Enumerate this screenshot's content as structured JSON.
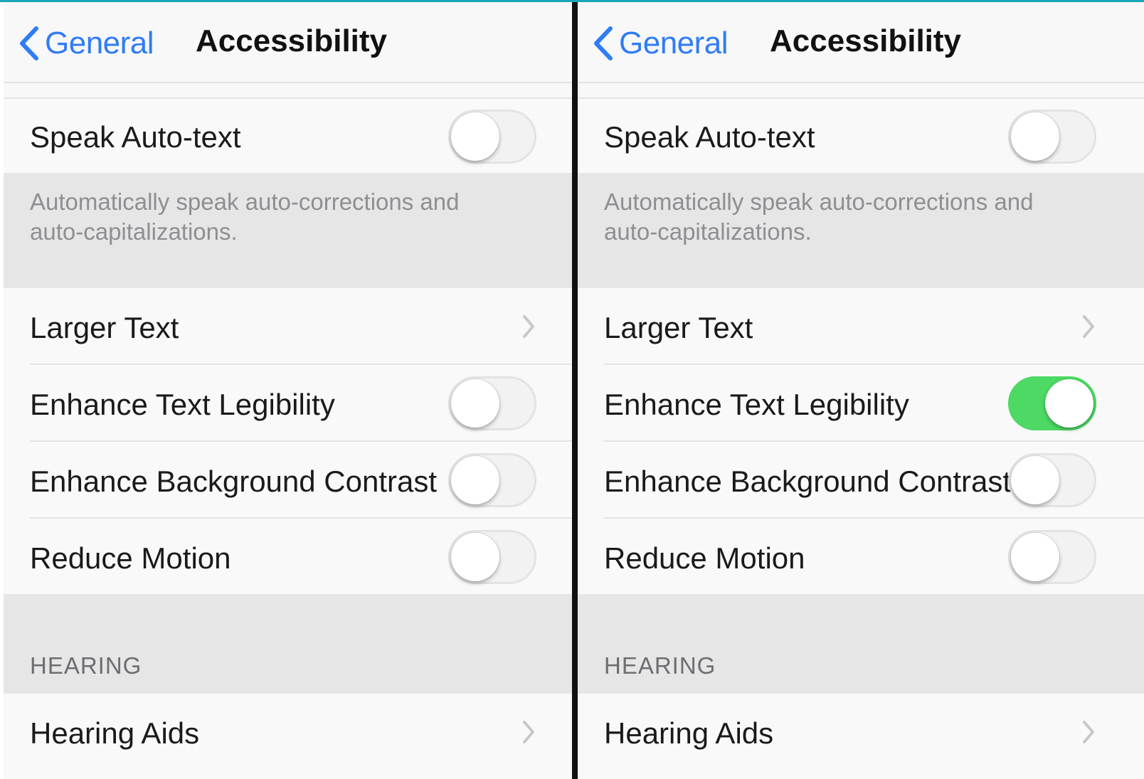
{
  "colors": {
    "accent": "#2f7cf6",
    "switch_on": "#4cd964",
    "switch_off": "#f2f2f2",
    "group_bg": "#e6e6e6"
  },
  "panels": [
    {
      "nav": {
        "back_label": "General",
        "back_icon": "chevron-left-icon",
        "title": "Accessibility"
      },
      "speak_auto_text": {
        "label": "Speak Auto-text",
        "on": false
      },
      "footer": "Automatically speak auto-corrections and auto-capitalizations.",
      "larger_text": {
        "label": "Larger Text",
        "icon": "chevron-right-icon"
      },
      "enhance_text_legibility": {
        "label": "Enhance Text Legibility",
        "on": false
      },
      "enhance_background_contrast": {
        "label": "Enhance Background Contrast",
        "on": false
      },
      "reduce_motion": {
        "label": "Reduce Motion",
        "on": false
      },
      "hearing_header": "HEARING",
      "hearing_aids": {
        "label": "Hearing Aids",
        "icon": "chevron-right-icon"
      }
    },
    {
      "nav": {
        "back_label": "General",
        "back_icon": "chevron-left-icon",
        "title": "Accessibility"
      },
      "speak_auto_text": {
        "label": "Speak Auto-text",
        "on": false
      },
      "footer": "Automatically speak auto-corrections and auto-capitalizations.",
      "larger_text": {
        "label": "Larger Text",
        "icon": "chevron-right-icon"
      },
      "enhance_text_legibility": {
        "label": "Enhance Text Legibility",
        "on": true
      },
      "enhance_background_contrast": {
        "label": "Enhance Background Contrast",
        "on": false
      },
      "reduce_motion": {
        "label": "Reduce Motion",
        "on": false
      },
      "hearing_header": "HEARING",
      "hearing_aids": {
        "label": "Hearing Aids",
        "icon": "chevron-right-icon"
      }
    }
  ]
}
